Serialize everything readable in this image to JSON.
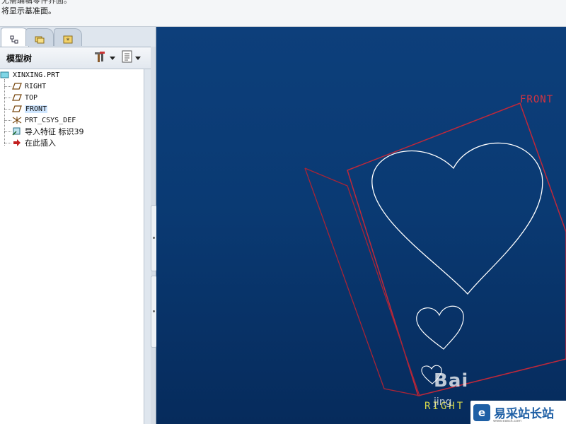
{
  "message_area": {
    "line1": "无需编辑零件界面。",
    "line2": "将显示基准面。"
  },
  "left_panel": {
    "tabs": [
      {
        "name": "model-tree",
        "icon": "model-tree-icon"
      },
      {
        "name": "folder-browser",
        "icon": "folder-icon"
      },
      {
        "name": "favorites",
        "icon": "favorites-icon"
      }
    ],
    "header_title": "模型树",
    "settings_icon": "tools-icon",
    "show_icon": "list-icon"
  },
  "tree": {
    "root": "XINXING.PRT",
    "items": [
      {
        "label": "RIGHT",
        "icon": "datum-plane-icon"
      },
      {
        "label": "TOP",
        "icon": "datum-plane-icon"
      },
      {
        "label": "FRONT",
        "icon": "datum-plane-icon",
        "selected": true
      },
      {
        "label": "PRT_CSYS_DEF",
        "icon": "csys-icon"
      },
      {
        "label": "导入特征 标识39",
        "icon": "import-feature-icon"
      },
      {
        "label": "在此插入",
        "icon": "insert-here-icon"
      }
    ]
  },
  "viewport": {
    "front_label": "FRONT",
    "right_label": "RIGHT",
    "watermark_baidu": "Bai",
    "watermark_jingyan": "jing",
    "logo_text": "易采站长站",
    "logo_url_text": "www.easck.com",
    "colors": {
      "background_top": "#0d3f7b",
      "background_bottom": "#062b5c",
      "datum_plane": "#c0283a",
      "curve": "#ffffff"
    }
  }
}
